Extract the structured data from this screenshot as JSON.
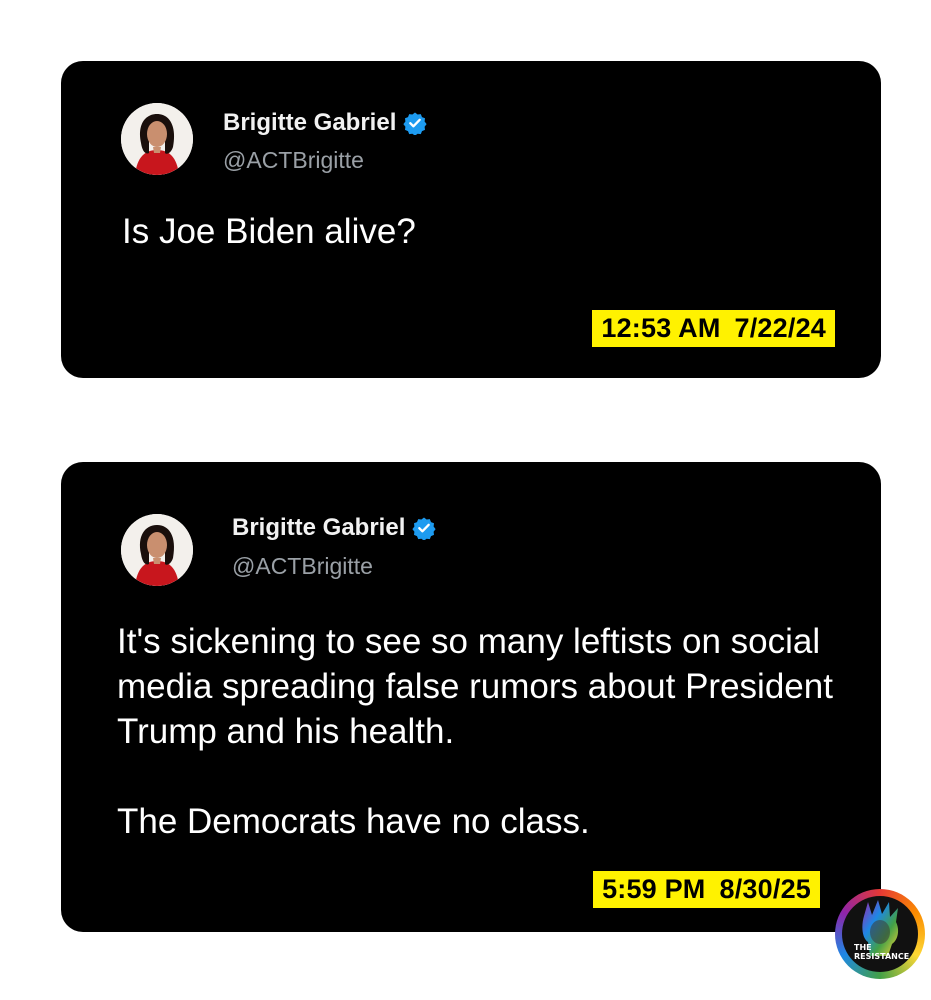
{
  "tweets": [
    {
      "author": {
        "name": "Brigitte Gabriel",
        "handle": "@ACTBrigitte",
        "verified": true
      },
      "text": [
        "Is Joe Biden alive?"
      ],
      "timestamp": {
        "time": "12:53 AM",
        "date": "7/22/24"
      }
    },
    {
      "author": {
        "name": "Brigitte Gabriel",
        "handle": "@ACTBrigitte",
        "verified": true
      },
      "text": [
        "It's sickening to see so many leftists on social media spreading false rumors about President Trump and his health.",
        "The Democrats have no class."
      ],
      "timestamp": {
        "time": "5:59 PM",
        "date": "8/30/25"
      }
    }
  ],
  "logo": {
    "line1": "THE",
    "line2": "RESISTANCE"
  },
  "colors": {
    "card": "#000000",
    "highlight": "#fff200",
    "verified": "#1d9bf0",
    "handle": "#9aa0a6"
  },
  "icons": {
    "verified": "verified-badge-icon",
    "avatar": "profile-photo"
  }
}
